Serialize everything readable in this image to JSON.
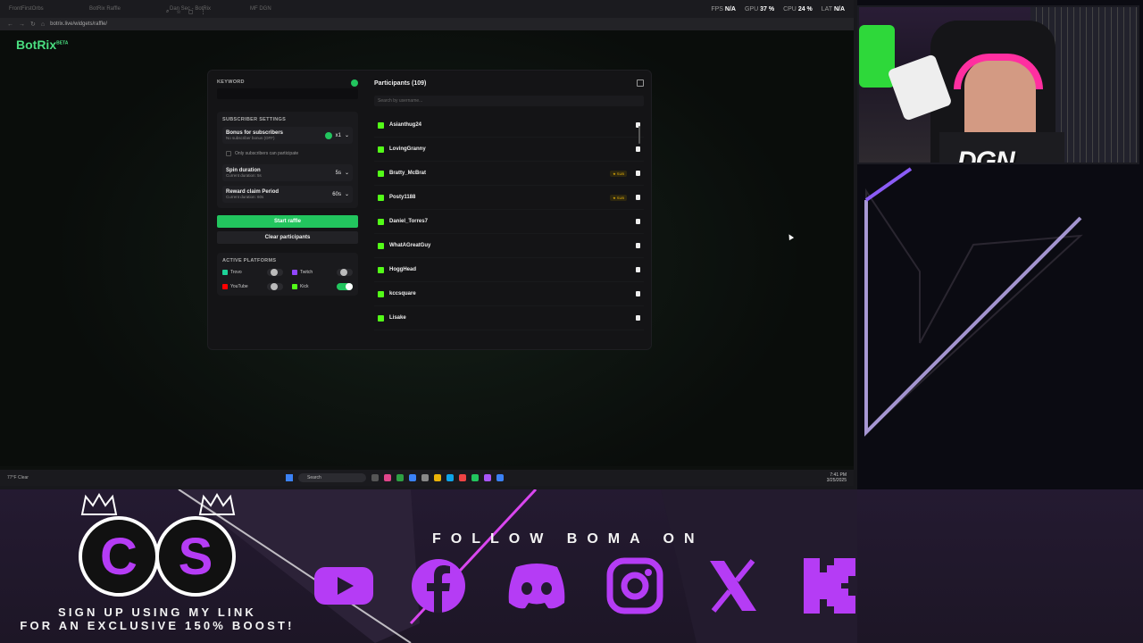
{
  "browser": {
    "tabs": [
      "FrontFirstOrbs",
      "BotRix Raffle",
      "Dan Sec - BotRix",
      "MF DGN"
    ],
    "stats": [
      {
        "label": "FPS",
        "value": "N/A"
      },
      {
        "label": "GPU",
        "value": "37 %"
      },
      {
        "label": "CPU",
        "value": "24 %"
      },
      {
        "label": "LAT",
        "value": "N/A"
      }
    ],
    "url": "botrix.live/widgets/raffle/"
  },
  "app": {
    "logo": "BotRix",
    "logo_badge": "BETA",
    "keyword_label": "KEYWORD",
    "keyword_value": "",
    "subscriber_settings_label": "SUBSCRIBER SETTINGS",
    "bonus": {
      "title": "Bonus for subscribers",
      "subtitle": "No subscriber bonus (OFF)",
      "value": "x1"
    },
    "only_subs": "Only subscribers can participate",
    "spin": {
      "title": "Spin duration",
      "subtitle": "Current duration: 5s",
      "value": "5s"
    },
    "claim": {
      "title": "Reward claim Period",
      "subtitle": "Current duration: 60s",
      "value": "60s"
    },
    "start_label": "Start raffle",
    "clear_label": "Clear participants",
    "platforms_label": "ACTIVE PLATFORMS",
    "platforms": [
      {
        "name": "Trovo",
        "on": false,
        "color": "#1dd398"
      },
      {
        "name": "Twitch",
        "on": false,
        "color": "#9146ff"
      },
      {
        "name": "YouTube",
        "on": false,
        "color": "#ff0000"
      },
      {
        "name": "Kick",
        "on": true,
        "color": "#53fc18"
      }
    ],
    "participants_title": "Participants (109)",
    "search_placeholder": "Search by username...",
    "participants": [
      {
        "name": "Asianthug24",
        "sub": false
      },
      {
        "name": "LovingGranny",
        "sub": false
      },
      {
        "name": "Bratty_McBrat",
        "sub": true
      },
      {
        "name": "Posty1188",
        "sub": true
      },
      {
        "name": "Daniel_Torres7",
        "sub": false
      },
      {
        "name": "WhatAGreatGuy",
        "sub": false
      },
      {
        "name": "HoggHead",
        "sub": false
      },
      {
        "name": "kccsquare",
        "sub": false
      },
      {
        "name": "Lisake",
        "sub": false
      }
    ],
    "sub_badge": "★ SUB"
  },
  "taskbar": {
    "weather_temp": "77°F",
    "weather_desc": "Clear",
    "search": "Search",
    "time": "7:41 PM",
    "date": "3/25/2025"
  },
  "overlay": {
    "cam_text": "DGN",
    "follow_text": "FOLLOW BOMA ON",
    "signup_line1": "SIGN UP USING MY LINK",
    "signup_line2": "FOR AN EXCLUSIVE 150% BOOST!",
    "logo_letters": [
      "C",
      "S"
    ],
    "socials": [
      "youtube-icon",
      "facebook-icon",
      "discord-icon",
      "instagram-icon",
      "x-icon",
      "kick-icon"
    ],
    "accent": "#b53cf5"
  }
}
